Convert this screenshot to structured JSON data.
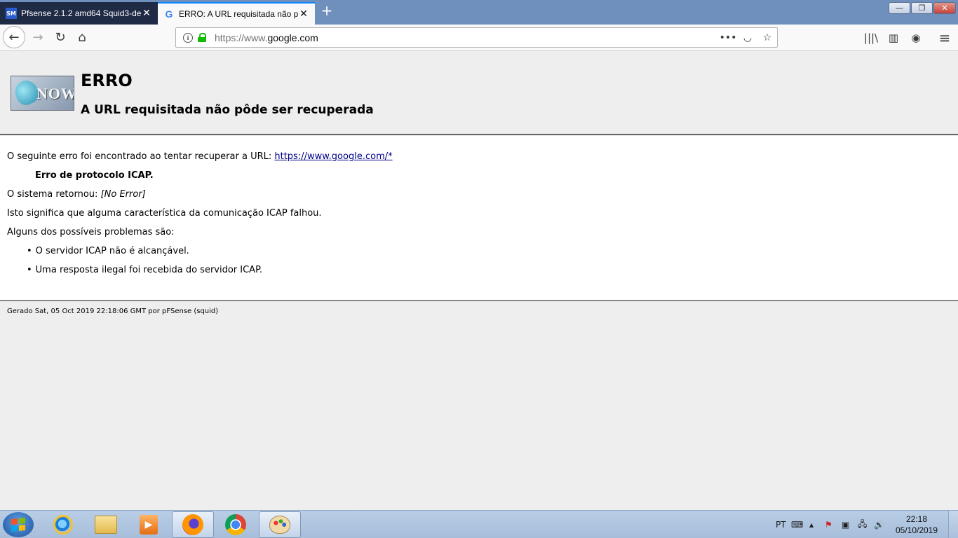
{
  "browser": {
    "tabs": [
      {
        "title": "Pfsense 2.1.2 amd64 Squid3-de",
        "favicon": "pfsense-favicon",
        "active": false
      },
      {
        "title": "ERRO: A URL requisitada não p",
        "favicon": "google-favicon",
        "active": true
      }
    ],
    "favicon_glyphs": {
      "pfsense": "SM",
      "google": "G"
    },
    "new_tab_label": "+",
    "close_glyph": "✕",
    "window_controls": {
      "minimize": "—",
      "maximize": "❐",
      "close": "✕"
    },
    "url": {
      "scheme": "https://www.",
      "host": "google.com"
    },
    "nav_glyphs": {
      "back": "←",
      "forward": "→",
      "reload": "↻",
      "home": "⌂"
    },
    "page_actions": {
      "more": "•••",
      "pocket": "◡",
      "bookmark": "☆"
    },
    "toolbar_glyphs": {
      "library": "|||\\",
      "sidebar": "▥",
      "account": "◉",
      "menu": "≡"
    },
    "accent_color": "#0a84ff"
  },
  "page": {
    "title": "ERRO",
    "subtitle": "A URL requisitada não pôde ser recuperada",
    "logo_text": "NOW",
    "intro_text": "O seguinte erro foi encontrado ao tentar recuperar a URL: ",
    "intro_link": "https://www.google.com/*",
    "error_message": "Erro de protocolo ICAP.",
    "system_prefix": "O sistema retornou: ",
    "system_error": "[No Error]",
    "meaning": "Isto significa que alguma característica da comunicação ICAP falhou.",
    "problems_intro": "Alguns dos possíveis problemas são:",
    "problems": [
      "O servidor ICAP não é alcançável.",
      "Uma resposta ilegal foi recebida do servidor ICAP."
    ],
    "footer": "Gerado Sat, 05 Oct 2019 22:18:06 GMT por pFSense (squid)"
  },
  "taskbar": {
    "apps": [
      "internet-explorer",
      "file-explorer",
      "media-player",
      "firefox",
      "chrome",
      "paint"
    ],
    "active_apps": [
      "firefox",
      "paint"
    ],
    "language": "PT",
    "tray_glyphs": {
      "keyboard": "⌨",
      "chevron": "▲",
      "flag": "⚑",
      "network": "🖧",
      "speaker": "🔊"
    },
    "time": "22:18",
    "date": "05/10/2019"
  }
}
